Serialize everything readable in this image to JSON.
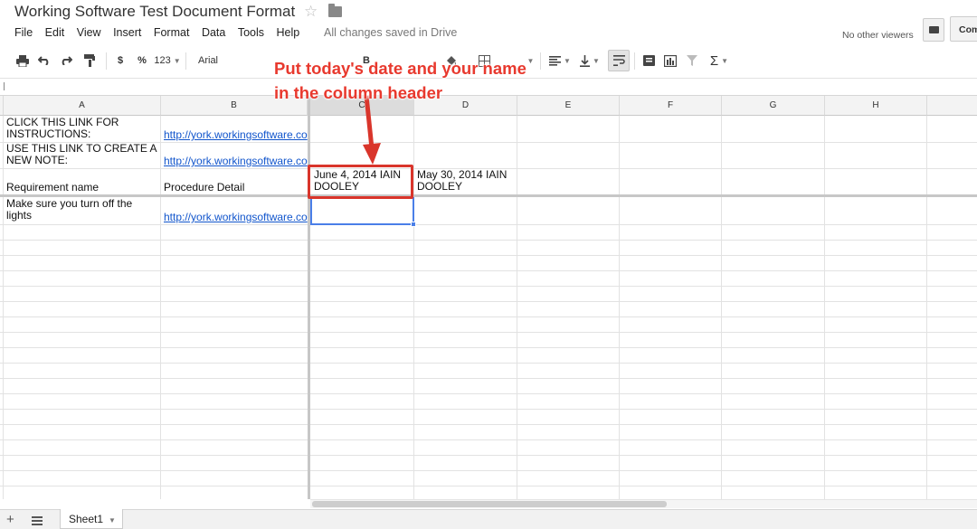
{
  "document": {
    "title": "Working Software Test Document Format",
    "status": "All changes saved in Drive",
    "viewers": "No other viewers",
    "share_label": "Com"
  },
  "menu": [
    "File",
    "Edit",
    "View",
    "Insert",
    "Format",
    "Data",
    "Tools",
    "Help"
  ],
  "toolbar": {
    "currency": "$",
    "percent": "%",
    "number_format": "123",
    "font": "Arial",
    "bold": "B",
    "sum": "Σ"
  },
  "columns": [
    "A",
    "B",
    "C",
    "D",
    "E",
    "F",
    "G",
    "H"
  ],
  "selected_column": "C",
  "cells": {
    "a1": "CLICK THIS LINK FOR INSTRUCTIONS:",
    "b1": "http://york.workingsoftware.co",
    "a2": "USE THIS LINK TO CREATE A NEW NOTE:",
    "b2": "http://york.workingsoftware.co",
    "a3": "Requirement name",
    "b3": "Procedure Detail",
    "c3": "June 4, 2014 IAIN DOOLEY",
    "d3": "May 30, 2014 IAIN DOOLEY",
    "a4": "Make sure you turn off the lights",
    "b4": "http://york.workingsoftware.co"
  },
  "annotation": {
    "text": "Put today's date and your name in the column header",
    "color": "#e8392e"
  },
  "sheets": {
    "active": "Sheet1"
  },
  "colors": {
    "link": "#1155cc",
    "selection": "#4a7fe8",
    "header_bg": "#f3f3f3"
  }
}
